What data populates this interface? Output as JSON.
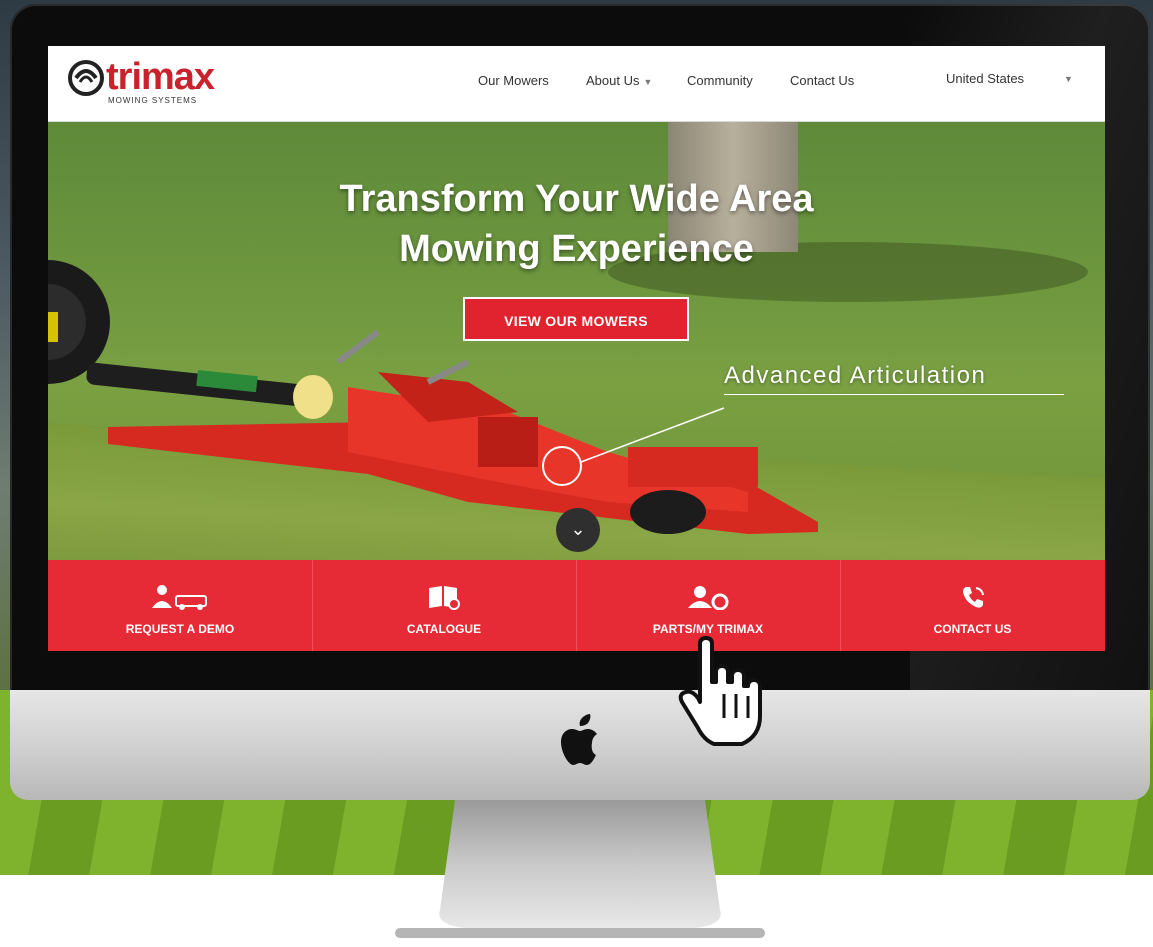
{
  "site": {
    "logo_word": "trimax",
    "logo_tagline": "MOWING SYSTEMS",
    "nav": [
      {
        "label": "Our Mowers",
        "has_caret": false
      },
      {
        "label": "About Us",
        "has_caret": true
      },
      {
        "label": "Community",
        "has_caret": false
      },
      {
        "label": "Contact Us",
        "has_caret": false
      }
    ],
    "country_selector": "United States"
  },
  "hero": {
    "title_line1": "Transform Your Wide Area",
    "title_line2": "Mowing Experience",
    "cta_label": "VIEW OUR MOWERS",
    "annotation": "Advanced Articulation"
  },
  "cta_bar": [
    {
      "label": "REQUEST A DEMO",
      "icon": "demo-icon"
    },
    {
      "label": "CATALOGUE",
      "icon": "catalogue-icon"
    },
    {
      "label": "PARTS/MY TRIMAX",
      "icon": "parts-icon"
    },
    {
      "label": "CONTACT US",
      "icon": "phone-icon"
    }
  ],
  "colors": {
    "brand_red": "#e62a36",
    "logo_red": "#c8232c"
  }
}
